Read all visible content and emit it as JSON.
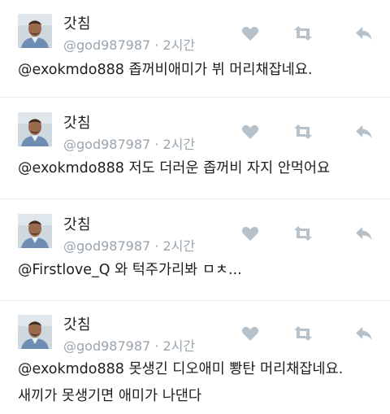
{
  "colors": {
    "meta": "#9aa5ae",
    "icon": "#b6c1c9",
    "divider": "#e6ecf0",
    "text": "#1e1e1e"
  },
  "icons": {
    "like": "heart-icon",
    "retweet": "retweet-icon",
    "reply": "reply-icon"
  },
  "tweets": [
    {
      "name": "갓침",
      "handle": "@god987987",
      "sep": "·",
      "time": "2시간",
      "text": "@exokmdo888 좁꺼비애미가 뷔 머리채잡네요."
    },
    {
      "name": "갓침",
      "handle": "@god987987",
      "sep": "·",
      "time": "2시간",
      "text": "@exokmdo888 저도 더러운 좁꺼비 자지 안먹어요"
    },
    {
      "name": "갓침",
      "handle": "@god987987",
      "sep": "·",
      "time": "2시간",
      "text": "@Firstlove_Q 와 턱주가리봐 ㅁㅊ..."
    },
    {
      "name": "갓침",
      "handle": "@god987987",
      "sep": "·",
      "time": "2시간",
      "text": "@exokmdo888 못생긴 디오애미 뽱탄 머리채잡네요. 새끼가 못생기면 애미가 나댄다"
    }
  ]
}
